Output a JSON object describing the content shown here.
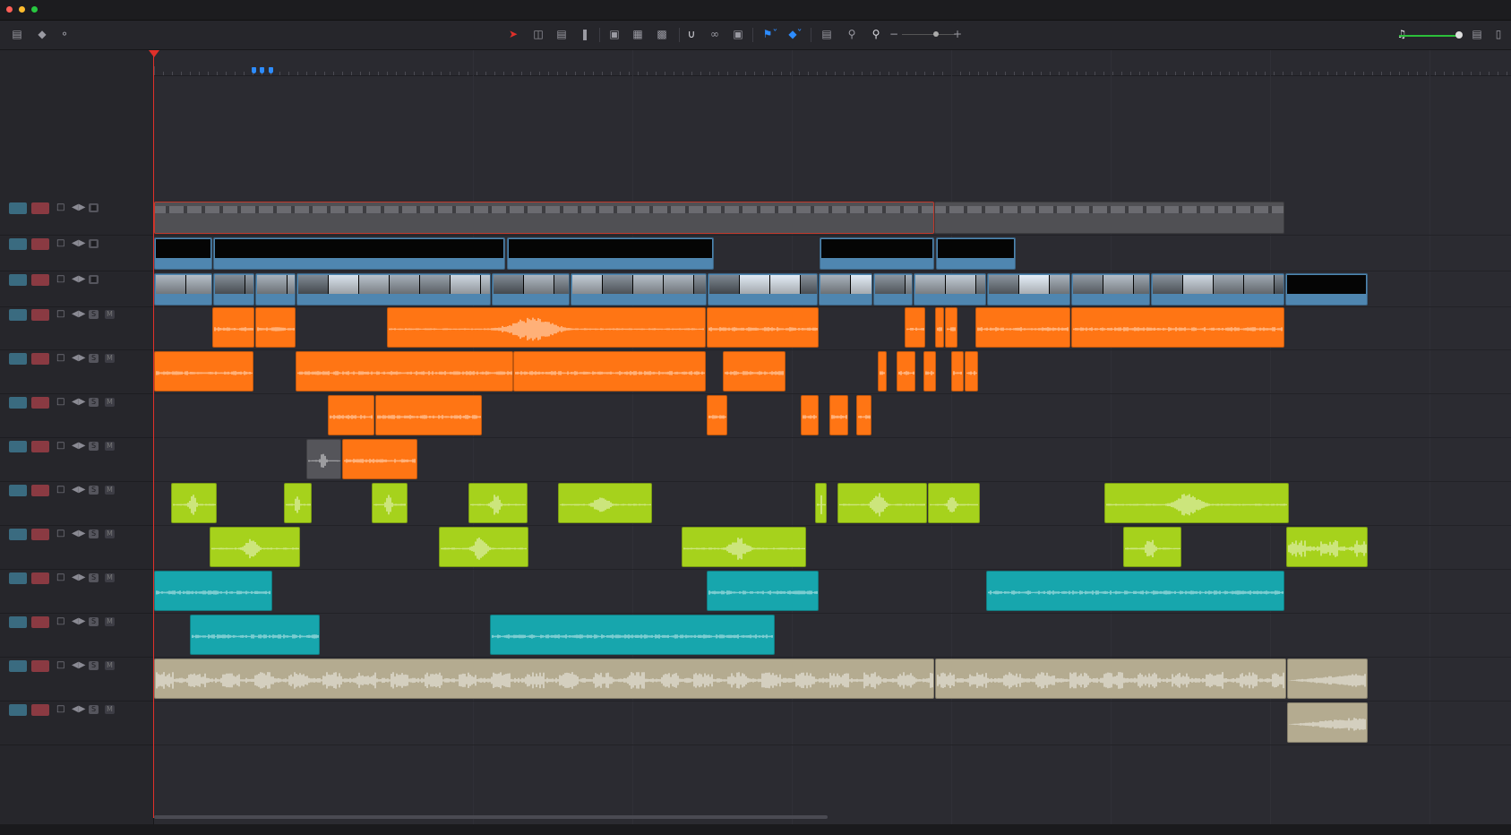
{
  "window": {
    "traffic_lights": [
      "#ff5f57",
      "#febc2e",
      "#28c840"
    ]
  },
  "toolbar": {
    "left_icons": [
      "timeline-view-options-icon",
      "audio-waveform-icon",
      "voiceover-mic-icon"
    ],
    "center_icons": [
      "selection-arrow-icon",
      "trim-edit-icon",
      "dynamic-trim-icon",
      "blade-icon",
      "insert-clip-icon",
      "overwrite-clip-icon",
      "replace-clip-icon",
      "snapping-icon",
      "linked-selection-icon",
      "position-lock-icon",
      "flag-icon",
      "marker-icon",
      "zoom-full-icon",
      "zoom-detail-icon",
      "zoom-custom-icon",
      "zoom-minus-icon",
      "zoom-plus-icon"
    ],
    "right_icons": [
      "speaker-icon",
      "mixer-icon"
    ],
    "volume_level": 0.95,
    "zoom_level": 0.55,
    "accent": "#2d8cff"
  },
  "tracks": [
    {
      "kind": "video",
      "id": "v4"
    },
    {
      "kind": "video",
      "id": "v3"
    },
    {
      "kind": "video",
      "id": "v2"
    },
    {
      "kind": "audio",
      "id": "a1",
      "color": "#ff7514"
    },
    {
      "kind": "audio",
      "id": "a2",
      "color": "#ff7514"
    },
    {
      "kind": "audio",
      "id": "a3",
      "color": "#ff7514"
    },
    {
      "kind": "audio",
      "id": "a4",
      "color": "#ff7514"
    },
    {
      "kind": "audio",
      "id": "a5",
      "color": "#a6d21c"
    },
    {
      "kind": "audio",
      "id": "a6",
      "color": "#a6d21c"
    },
    {
      "kind": "audio",
      "id": "a7",
      "color": "#17a6ad"
    },
    {
      "kind": "audio",
      "id": "a8",
      "color": "#17a6ad"
    },
    {
      "kind": "audio",
      "id": "a9",
      "color": "#b4ab90"
    },
    {
      "kind": "audio",
      "id": "a10",
      "color": "#b4ab90"
    }
  ],
  "clip_colors": {
    "orange": "#ff7514",
    "lime": "#a6d21c",
    "teal": "#17a6ad",
    "tan": "#b4ab90",
    "video_blue": "#4f86b0",
    "adjust_gray": "#5a5a5c",
    "playhead": "#e0302a"
  }
}
